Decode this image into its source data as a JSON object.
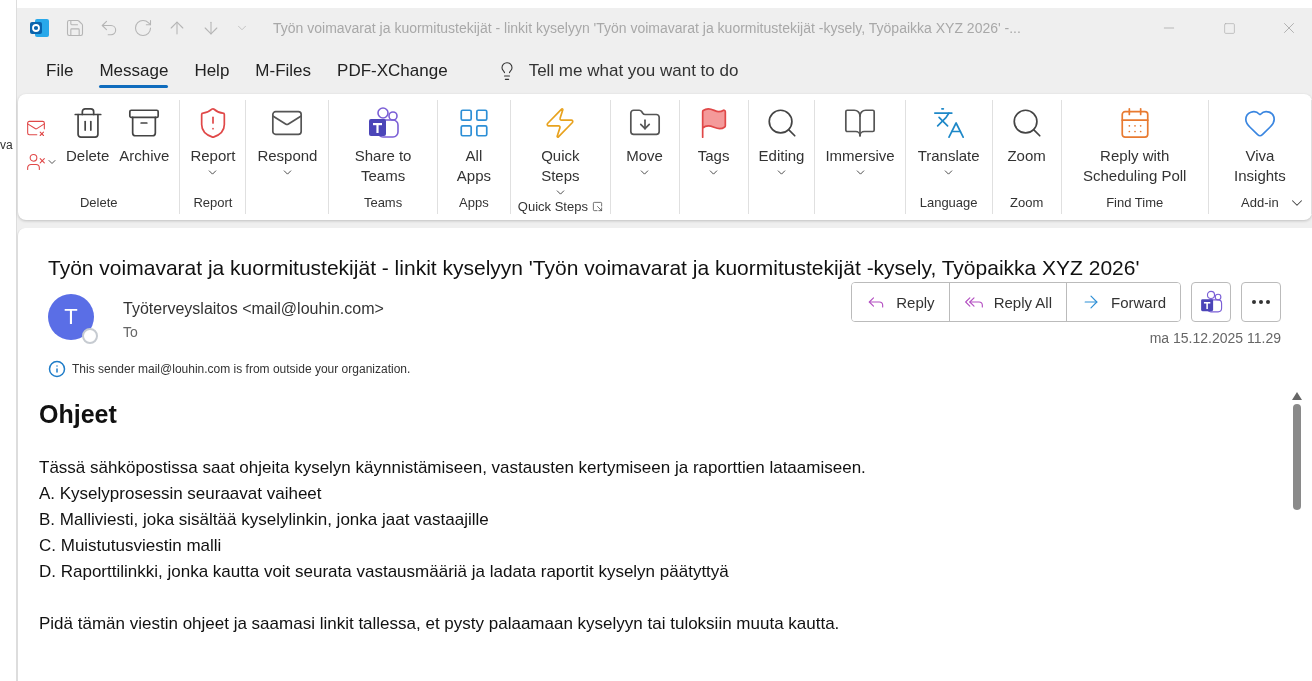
{
  "background_window": {
    "text": "va"
  },
  "window": {
    "title": "Työn voimavarat ja kuormitustekijät - linkit kyselyyn 'Työn voimavarat ja kuormitustekijät -kysely, Työpaikka XYZ 2026'  -..."
  },
  "menu_tabs": [
    {
      "label": "File",
      "selected": false
    },
    {
      "label": "Message",
      "selected": true
    },
    {
      "label": "Help",
      "selected": false
    },
    {
      "label": "M-Files",
      "selected": false
    },
    {
      "label": "PDF-XChange",
      "selected": false
    }
  ],
  "tell_me": {
    "placeholder": "Tell me what you want to do"
  },
  "ribbon": {
    "groups": [
      {
        "label": "Delete",
        "buttons": [
          {
            "label": "Delete",
            "dropdown": false
          },
          {
            "label": "Archive",
            "dropdown": false
          }
        ]
      },
      {
        "label": "Report",
        "buttons": [
          {
            "label": "Report",
            "dropdown": true
          }
        ]
      },
      {
        "buttons": [
          {
            "label": "Respond",
            "dropdown": true
          }
        ]
      },
      {
        "label": "Teams",
        "buttons": [
          {
            "label": "Share to Teams",
            "dropdown": false
          }
        ]
      },
      {
        "label": "Apps",
        "buttons": [
          {
            "label": "All Apps",
            "dropdown": false
          }
        ]
      },
      {
        "label": "Quick Steps",
        "buttons": [
          {
            "label": "Quick Steps",
            "dropdown": true
          }
        ]
      },
      {
        "buttons": [
          {
            "label": "Move",
            "dropdown": true
          }
        ]
      },
      {
        "buttons": [
          {
            "label": "Tags",
            "dropdown": true
          }
        ]
      },
      {
        "buttons": [
          {
            "label": "Editing",
            "dropdown": true
          }
        ]
      },
      {
        "buttons": [
          {
            "label": "Immersive",
            "dropdown": true
          }
        ]
      },
      {
        "label": "Language",
        "buttons": [
          {
            "label": "Translate",
            "dropdown": true
          }
        ]
      },
      {
        "label": "Zoom",
        "buttons": [
          {
            "label": "Zoom",
            "dropdown": false
          }
        ]
      },
      {
        "label": "Find Time",
        "buttons": [
          {
            "label": "Reply with Scheduling Poll",
            "dropdown": false
          }
        ]
      },
      {
        "label": "Add-in",
        "buttons": [
          {
            "label": "Viva Insights",
            "dropdown": false
          }
        ]
      }
    ]
  },
  "email": {
    "subject": "Työn voimavarat ja kuormitustekijät - linkit kyselyyn 'Työn voimavarat ja kuormitustekijät -kysely, Työpaikka XYZ 2026'",
    "avatar": "T",
    "sender": "Työterveyslaitos <mail@louhin.com>",
    "to": "To",
    "actions": [
      "Reply",
      "Reply All",
      "Forward"
    ],
    "date": "ma 15.12.2025 11.29",
    "notice": "This sender mail@louhin.com is from outside your organization.",
    "body": {
      "heading": "Ohjeet",
      "intro": "Tässä sähköpostissa saat ohjeita kyselyn käynnistämiseen, vastausten kertymiseen ja raporttien lataamiseen.",
      "items": [
        "A. Kyselyprosessin seuraavat vaiheet",
        "B. Malliviesti, joka sisältää kyselylinkin, jonka jaat vastaajille",
        "C. Muistutusviestin malli",
        "D. Raporttilinkki, jonka kautta voit seurata vastausmääriä ja ladata raportit kyselyn päätyttyä"
      ],
      "closing": "Pidä tämän viestin ohjeet ja saamasi linkit tallessa, et pysty palaamaan kyselyyn tai tuloksiin muuta kautta."
    }
  }
}
